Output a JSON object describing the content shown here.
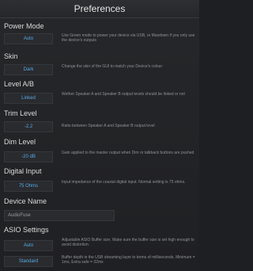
{
  "window": {
    "title": "Preferences"
  },
  "sections": {
    "power_mode": {
      "label": "Power Mode",
      "button": "Auto",
      "description": "Use Green mode to power your device via USB, or Maxdown if you only use the device's outputs"
    },
    "skin": {
      "label": "Skin",
      "button": "Dark",
      "description": "Change the skin of the GUI to match your Device's colour"
    },
    "level_ab": {
      "label": "Level A/B",
      "button": "Linked",
      "description": "Wether Speaker A and Speaker B output levels should be linked or not"
    },
    "trim_level": {
      "label": "Trim Level",
      "button": "-2.2",
      "description": "Ratio between Speaker A and Speaker B output level"
    },
    "dim_level": {
      "label": "Dim Level",
      "button": "-20 dB",
      "description": "Gain applied to the master output when Dim or talkback buttons are pushed"
    },
    "digital_input": {
      "label": "Digital Input",
      "button": "75 Ohms",
      "description": "Input impedance of the coaxial digital input. Normal setting is 75 ohms."
    },
    "device_name": {
      "label": "Device Name",
      "value": "AudioFuse"
    },
    "asio_settings": {
      "label": "ASIO Settings",
      "buffer_button": "Auto",
      "buffer_description": "Adjustable ASIO Buffer size. Make sure the buffer size is set high enough to avoid distortion.",
      "safety_button": "Standard",
      "safety_description": "Buffer depth in the USB streaming layer in terms of milliseconds. Minimum = 1ms, Extra safe = 32ms"
    }
  },
  "colors": {
    "background": "#1e1f22",
    "button_text": "#58a9e6",
    "label_text": "#d9d9d9",
    "description_text": "#8f9196"
  }
}
